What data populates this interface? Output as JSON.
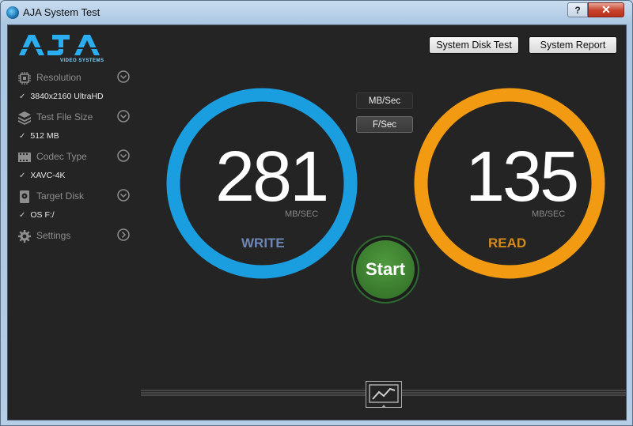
{
  "window": {
    "title": "AJA System Test",
    "help_label": "?",
    "close_label": "✕"
  },
  "logo": {
    "text": "AJA",
    "subtext": "VIDEO SYSTEMS"
  },
  "sidebar": {
    "items": [
      {
        "label": "Resolution",
        "value": "3840x2160 UltraHD",
        "icon": "chip-icon",
        "expander": "chevron-down-icon"
      },
      {
        "label": "Test File Size",
        "value": "512 MB",
        "icon": "stack-icon",
        "expander": "chevron-down-icon"
      },
      {
        "label": "Codec Type",
        "value": "XAVC-4K",
        "icon": "film-icon",
        "expander": "chevron-down-icon"
      },
      {
        "label": "Target Disk",
        "value": "OS F:/",
        "icon": "disk-icon",
        "expander": "chevron-down-icon"
      },
      {
        "label": "Settings",
        "value": "",
        "icon": "gear-icon",
        "expander": "chevron-right-icon"
      }
    ],
    "check": "✓"
  },
  "toolbar": {
    "disk_test_label": "System Disk Test",
    "report_label": "System Report"
  },
  "units": {
    "mb_label": "MB/Sec",
    "f_label": "F/Sec"
  },
  "write": {
    "value": "281",
    "unit": "MB/SEC",
    "label": "WRITE",
    "color": "#1a9ee0",
    "label_color": "#6d87b5"
  },
  "read": {
    "value": "135",
    "unit": "MB/SEC",
    "label": "READ",
    "color": "#f29b12",
    "label_color": "#d48a1a"
  },
  "start": {
    "label": "Start",
    "color": "#3a7d2e"
  },
  "graph": {
    "icon": "graph-icon"
  }
}
